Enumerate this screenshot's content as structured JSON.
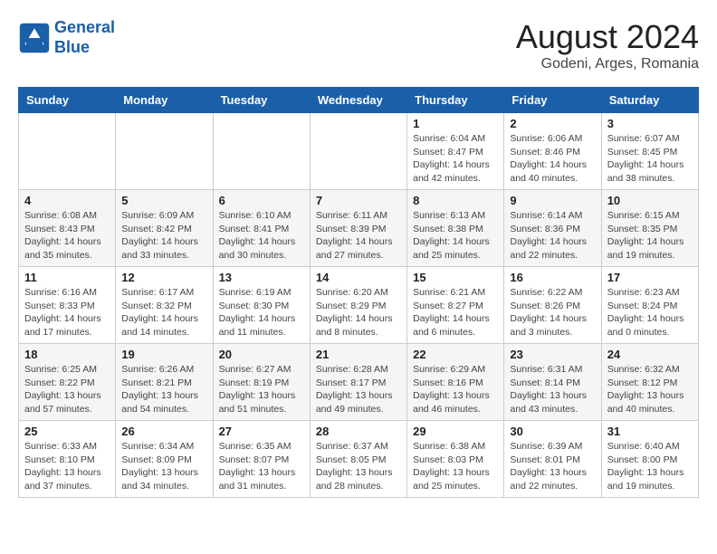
{
  "header": {
    "logo_line1": "General",
    "logo_line2": "Blue",
    "month": "August 2024",
    "location": "Godeni, Arges, Romania"
  },
  "weekdays": [
    "Sunday",
    "Monday",
    "Tuesday",
    "Wednesday",
    "Thursday",
    "Friday",
    "Saturday"
  ],
  "weeks": [
    [
      {
        "day": "",
        "info": ""
      },
      {
        "day": "",
        "info": ""
      },
      {
        "day": "",
        "info": ""
      },
      {
        "day": "",
        "info": ""
      },
      {
        "day": "1",
        "info": "Sunrise: 6:04 AM\nSunset: 8:47 PM\nDaylight: 14 hours\nand 42 minutes."
      },
      {
        "day": "2",
        "info": "Sunrise: 6:06 AM\nSunset: 8:46 PM\nDaylight: 14 hours\nand 40 minutes."
      },
      {
        "day": "3",
        "info": "Sunrise: 6:07 AM\nSunset: 8:45 PM\nDaylight: 14 hours\nand 38 minutes."
      }
    ],
    [
      {
        "day": "4",
        "info": "Sunrise: 6:08 AM\nSunset: 8:43 PM\nDaylight: 14 hours\nand 35 minutes."
      },
      {
        "day": "5",
        "info": "Sunrise: 6:09 AM\nSunset: 8:42 PM\nDaylight: 14 hours\nand 33 minutes."
      },
      {
        "day": "6",
        "info": "Sunrise: 6:10 AM\nSunset: 8:41 PM\nDaylight: 14 hours\nand 30 minutes."
      },
      {
        "day": "7",
        "info": "Sunrise: 6:11 AM\nSunset: 8:39 PM\nDaylight: 14 hours\nand 27 minutes."
      },
      {
        "day": "8",
        "info": "Sunrise: 6:13 AM\nSunset: 8:38 PM\nDaylight: 14 hours\nand 25 minutes."
      },
      {
        "day": "9",
        "info": "Sunrise: 6:14 AM\nSunset: 8:36 PM\nDaylight: 14 hours\nand 22 minutes."
      },
      {
        "day": "10",
        "info": "Sunrise: 6:15 AM\nSunset: 8:35 PM\nDaylight: 14 hours\nand 19 minutes."
      }
    ],
    [
      {
        "day": "11",
        "info": "Sunrise: 6:16 AM\nSunset: 8:33 PM\nDaylight: 14 hours\nand 17 minutes."
      },
      {
        "day": "12",
        "info": "Sunrise: 6:17 AM\nSunset: 8:32 PM\nDaylight: 14 hours\nand 14 minutes."
      },
      {
        "day": "13",
        "info": "Sunrise: 6:19 AM\nSunset: 8:30 PM\nDaylight: 14 hours\nand 11 minutes."
      },
      {
        "day": "14",
        "info": "Sunrise: 6:20 AM\nSunset: 8:29 PM\nDaylight: 14 hours\nand 8 minutes."
      },
      {
        "day": "15",
        "info": "Sunrise: 6:21 AM\nSunset: 8:27 PM\nDaylight: 14 hours\nand 6 minutes."
      },
      {
        "day": "16",
        "info": "Sunrise: 6:22 AM\nSunset: 8:26 PM\nDaylight: 14 hours\nand 3 minutes."
      },
      {
        "day": "17",
        "info": "Sunrise: 6:23 AM\nSunset: 8:24 PM\nDaylight: 14 hours\nand 0 minutes."
      }
    ],
    [
      {
        "day": "18",
        "info": "Sunrise: 6:25 AM\nSunset: 8:22 PM\nDaylight: 13 hours\nand 57 minutes."
      },
      {
        "day": "19",
        "info": "Sunrise: 6:26 AM\nSunset: 8:21 PM\nDaylight: 13 hours\nand 54 minutes."
      },
      {
        "day": "20",
        "info": "Sunrise: 6:27 AM\nSunset: 8:19 PM\nDaylight: 13 hours\nand 51 minutes."
      },
      {
        "day": "21",
        "info": "Sunrise: 6:28 AM\nSunset: 8:17 PM\nDaylight: 13 hours\nand 49 minutes."
      },
      {
        "day": "22",
        "info": "Sunrise: 6:29 AM\nSunset: 8:16 PM\nDaylight: 13 hours\nand 46 minutes."
      },
      {
        "day": "23",
        "info": "Sunrise: 6:31 AM\nSunset: 8:14 PM\nDaylight: 13 hours\nand 43 minutes."
      },
      {
        "day": "24",
        "info": "Sunrise: 6:32 AM\nSunset: 8:12 PM\nDaylight: 13 hours\nand 40 minutes."
      }
    ],
    [
      {
        "day": "25",
        "info": "Sunrise: 6:33 AM\nSunset: 8:10 PM\nDaylight: 13 hours\nand 37 minutes."
      },
      {
        "day": "26",
        "info": "Sunrise: 6:34 AM\nSunset: 8:09 PM\nDaylight: 13 hours\nand 34 minutes."
      },
      {
        "day": "27",
        "info": "Sunrise: 6:35 AM\nSunset: 8:07 PM\nDaylight: 13 hours\nand 31 minutes."
      },
      {
        "day": "28",
        "info": "Sunrise: 6:37 AM\nSunset: 8:05 PM\nDaylight: 13 hours\nand 28 minutes."
      },
      {
        "day": "29",
        "info": "Sunrise: 6:38 AM\nSunset: 8:03 PM\nDaylight: 13 hours\nand 25 minutes."
      },
      {
        "day": "30",
        "info": "Sunrise: 6:39 AM\nSunset: 8:01 PM\nDaylight: 13 hours\nand 22 minutes."
      },
      {
        "day": "31",
        "info": "Sunrise: 6:40 AM\nSunset: 8:00 PM\nDaylight: 13 hours\nand 19 minutes."
      }
    ]
  ]
}
